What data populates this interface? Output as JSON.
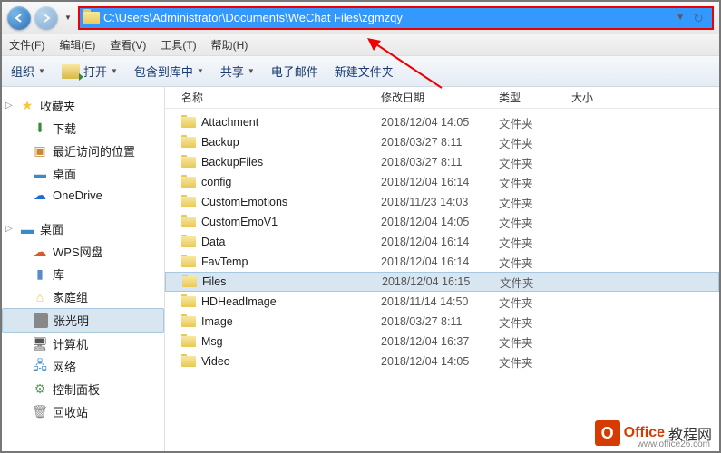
{
  "address": {
    "path": "C:\\Users\\Administrator\\Documents\\WeChat Files\\zgmzqy"
  },
  "menu": {
    "file": "文件(F)",
    "edit": "编辑(E)",
    "view": "查看(V)",
    "tools": "工具(T)",
    "help": "帮助(H)"
  },
  "toolbar": {
    "organize": "组织",
    "open": "打开",
    "include": "包含到库中",
    "share": "共享",
    "email": "电子邮件",
    "newfolder": "新建文件夹"
  },
  "sidebar": {
    "favorites": "收藏夹",
    "downloads": "下载",
    "recent": "最近访问的位置",
    "desktop": "桌面",
    "onedrive": "OneDrive",
    "desktop2": "桌面",
    "wps": "WPS网盘",
    "library": "库",
    "homegroup": "家庭组",
    "user": "张光明",
    "computer": "计算机",
    "network": "网络",
    "control": "控制面板",
    "recyclebin": "回收站"
  },
  "columns": {
    "name": "名称",
    "date": "修改日期",
    "type": "类型",
    "size": "大小"
  },
  "files": [
    {
      "name": "Attachment",
      "date": "2018/12/04 14:05",
      "type": "文件夹"
    },
    {
      "name": "Backup",
      "date": "2018/03/27 8:11",
      "type": "文件夹"
    },
    {
      "name": "BackupFiles",
      "date": "2018/03/27 8:11",
      "type": "文件夹"
    },
    {
      "name": "config",
      "date": "2018/12/04 16:14",
      "type": "文件夹"
    },
    {
      "name": "CustomEmotions",
      "date": "2018/11/23 14:03",
      "type": "文件夹"
    },
    {
      "name": "CustomEmoV1",
      "date": "2018/12/04 14:05",
      "type": "文件夹"
    },
    {
      "name": "Data",
      "date": "2018/12/04 16:14",
      "type": "文件夹"
    },
    {
      "name": "FavTemp",
      "date": "2018/12/04 16:14",
      "type": "文件夹"
    },
    {
      "name": "Files",
      "date": "2018/12/04 16:15",
      "type": "文件夹",
      "selected": true
    },
    {
      "name": "HDHeadImage",
      "date": "2018/11/14 14:50",
      "type": "文件夹"
    },
    {
      "name": "Image",
      "date": "2018/03/27 8:11",
      "type": "文件夹"
    },
    {
      "name": "Msg",
      "date": "2018/12/04 16:37",
      "type": "文件夹"
    },
    {
      "name": "Video",
      "date": "2018/12/04 14:05",
      "type": "文件夹"
    }
  ],
  "watermark": {
    "brand": "Office",
    "suffix": "教程网",
    "url": "www.office26.com"
  }
}
